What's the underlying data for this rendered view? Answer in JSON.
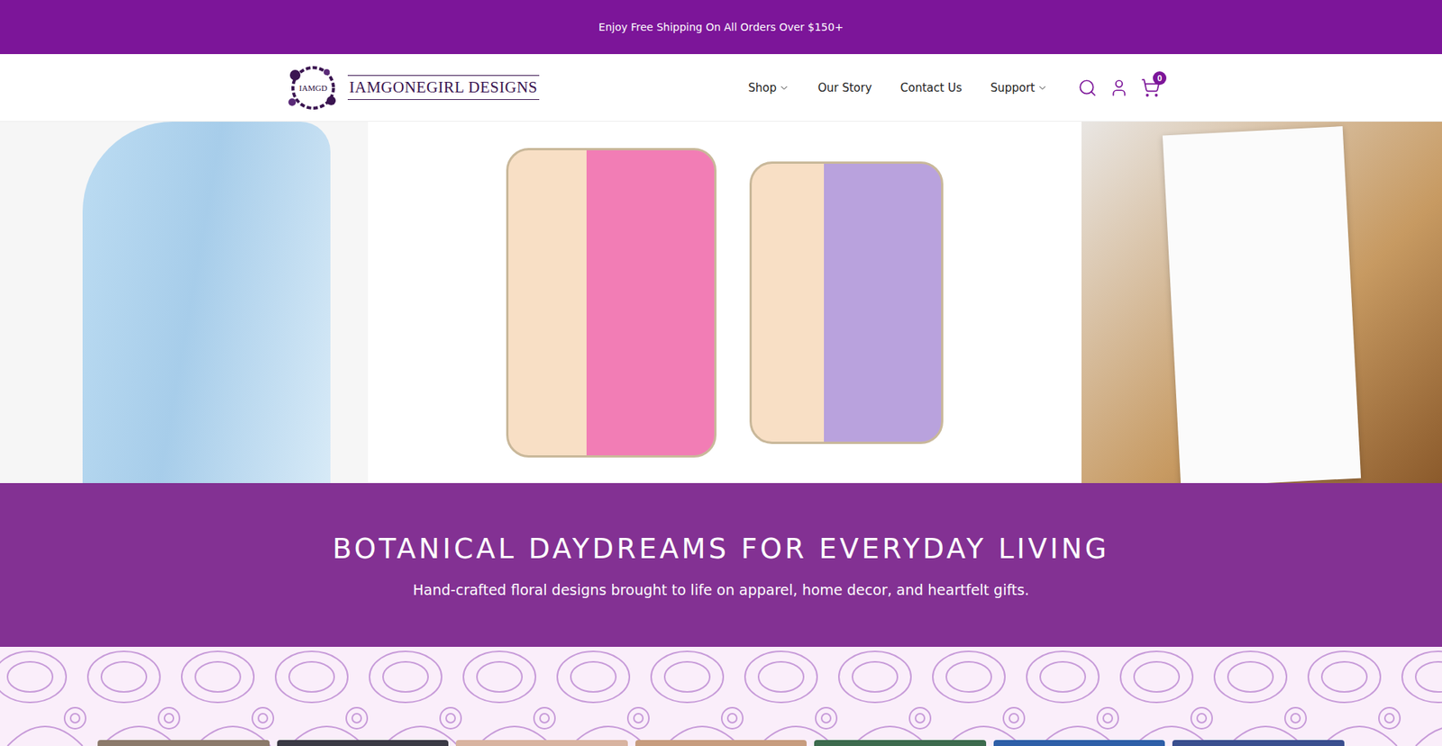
{
  "announcement": {
    "text": "Enjoy Free Shipping On All Orders Over $150+"
  },
  "logo": {
    "badge": "IAMGD",
    "name": "IAMGONEGIRL DESIGNS"
  },
  "nav": [
    {
      "label": "Shop",
      "dropdown": true
    },
    {
      "label": "Our Story",
      "dropdown": false
    },
    {
      "label": "Contact Us",
      "dropdown": false
    },
    {
      "label": "Support",
      "dropdown": true
    }
  ],
  "cart": {
    "count": "0"
  },
  "banner": {
    "title": "BOTANICAL DAYDREAMS FOR EVERYDAY LIVING",
    "subtitle": "Hand-crafted floral designs brought to life on apparel, home decor, and heartfelt gifts."
  }
}
